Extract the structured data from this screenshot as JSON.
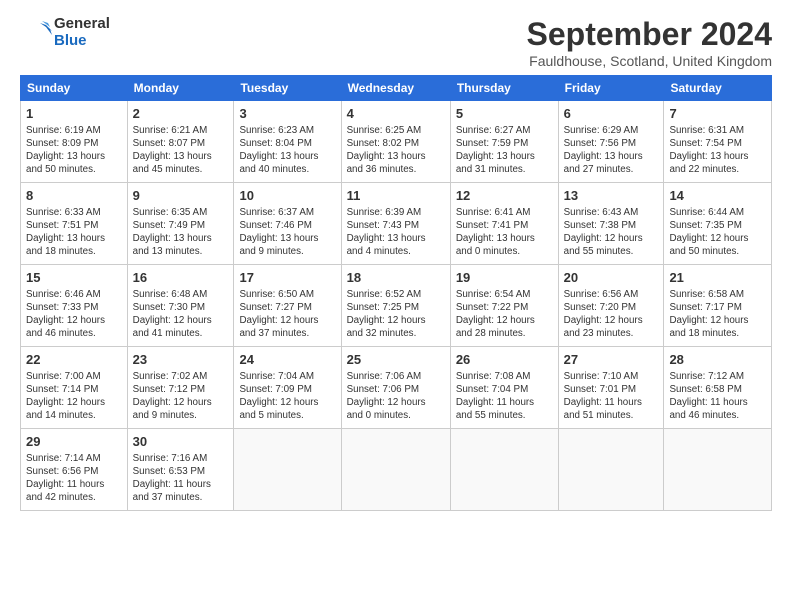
{
  "header": {
    "logo_line1": "General",
    "logo_line2": "Blue",
    "month_title": "September 2024",
    "location": "Fauldhouse, Scotland, United Kingdom"
  },
  "days_of_week": [
    "Sunday",
    "Monday",
    "Tuesday",
    "Wednesday",
    "Thursday",
    "Friday",
    "Saturday"
  ],
  "weeks": [
    [
      {
        "day": "1",
        "info": "Sunrise: 6:19 AM\nSunset: 8:09 PM\nDaylight: 13 hours\nand 50 minutes."
      },
      {
        "day": "2",
        "info": "Sunrise: 6:21 AM\nSunset: 8:07 PM\nDaylight: 13 hours\nand 45 minutes."
      },
      {
        "day": "3",
        "info": "Sunrise: 6:23 AM\nSunset: 8:04 PM\nDaylight: 13 hours\nand 40 minutes."
      },
      {
        "day": "4",
        "info": "Sunrise: 6:25 AM\nSunset: 8:02 PM\nDaylight: 13 hours\nand 36 minutes."
      },
      {
        "day": "5",
        "info": "Sunrise: 6:27 AM\nSunset: 7:59 PM\nDaylight: 13 hours\nand 31 minutes."
      },
      {
        "day": "6",
        "info": "Sunrise: 6:29 AM\nSunset: 7:56 PM\nDaylight: 13 hours\nand 27 minutes."
      },
      {
        "day": "7",
        "info": "Sunrise: 6:31 AM\nSunset: 7:54 PM\nDaylight: 13 hours\nand 22 minutes."
      }
    ],
    [
      {
        "day": "8",
        "info": "Sunrise: 6:33 AM\nSunset: 7:51 PM\nDaylight: 13 hours\nand 18 minutes."
      },
      {
        "day": "9",
        "info": "Sunrise: 6:35 AM\nSunset: 7:49 PM\nDaylight: 13 hours\nand 13 minutes."
      },
      {
        "day": "10",
        "info": "Sunrise: 6:37 AM\nSunset: 7:46 PM\nDaylight: 13 hours\nand 9 minutes."
      },
      {
        "day": "11",
        "info": "Sunrise: 6:39 AM\nSunset: 7:43 PM\nDaylight: 13 hours\nand 4 minutes."
      },
      {
        "day": "12",
        "info": "Sunrise: 6:41 AM\nSunset: 7:41 PM\nDaylight: 13 hours\nand 0 minutes."
      },
      {
        "day": "13",
        "info": "Sunrise: 6:43 AM\nSunset: 7:38 PM\nDaylight: 12 hours\nand 55 minutes."
      },
      {
        "day": "14",
        "info": "Sunrise: 6:44 AM\nSunset: 7:35 PM\nDaylight: 12 hours\nand 50 minutes."
      }
    ],
    [
      {
        "day": "15",
        "info": "Sunrise: 6:46 AM\nSunset: 7:33 PM\nDaylight: 12 hours\nand 46 minutes."
      },
      {
        "day": "16",
        "info": "Sunrise: 6:48 AM\nSunset: 7:30 PM\nDaylight: 12 hours\nand 41 minutes."
      },
      {
        "day": "17",
        "info": "Sunrise: 6:50 AM\nSunset: 7:27 PM\nDaylight: 12 hours\nand 37 minutes."
      },
      {
        "day": "18",
        "info": "Sunrise: 6:52 AM\nSunset: 7:25 PM\nDaylight: 12 hours\nand 32 minutes."
      },
      {
        "day": "19",
        "info": "Sunrise: 6:54 AM\nSunset: 7:22 PM\nDaylight: 12 hours\nand 28 minutes."
      },
      {
        "day": "20",
        "info": "Sunrise: 6:56 AM\nSunset: 7:20 PM\nDaylight: 12 hours\nand 23 minutes."
      },
      {
        "day": "21",
        "info": "Sunrise: 6:58 AM\nSunset: 7:17 PM\nDaylight: 12 hours\nand 18 minutes."
      }
    ],
    [
      {
        "day": "22",
        "info": "Sunrise: 7:00 AM\nSunset: 7:14 PM\nDaylight: 12 hours\nand 14 minutes."
      },
      {
        "day": "23",
        "info": "Sunrise: 7:02 AM\nSunset: 7:12 PM\nDaylight: 12 hours\nand 9 minutes."
      },
      {
        "day": "24",
        "info": "Sunrise: 7:04 AM\nSunset: 7:09 PM\nDaylight: 12 hours\nand 5 minutes."
      },
      {
        "day": "25",
        "info": "Sunrise: 7:06 AM\nSunset: 7:06 PM\nDaylight: 12 hours\nand 0 minutes."
      },
      {
        "day": "26",
        "info": "Sunrise: 7:08 AM\nSunset: 7:04 PM\nDaylight: 11 hours\nand 55 minutes."
      },
      {
        "day": "27",
        "info": "Sunrise: 7:10 AM\nSunset: 7:01 PM\nDaylight: 11 hours\nand 51 minutes."
      },
      {
        "day": "28",
        "info": "Sunrise: 7:12 AM\nSunset: 6:58 PM\nDaylight: 11 hours\nand 46 minutes."
      }
    ],
    [
      {
        "day": "29",
        "info": "Sunrise: 7:14 AM\nSunset: 6:56 PM\nDaylight: 11 hours\nand 42 minutes."
      },
      {
        "day": "30",
        "info": "Sunrise: 7:16 AM\nSunset: 6:53 PM\nDaylight: 11 hours\nand 37 minutes."
      },
      null,
      null,
      null,
      null,
      null
    ]
  ]
}
